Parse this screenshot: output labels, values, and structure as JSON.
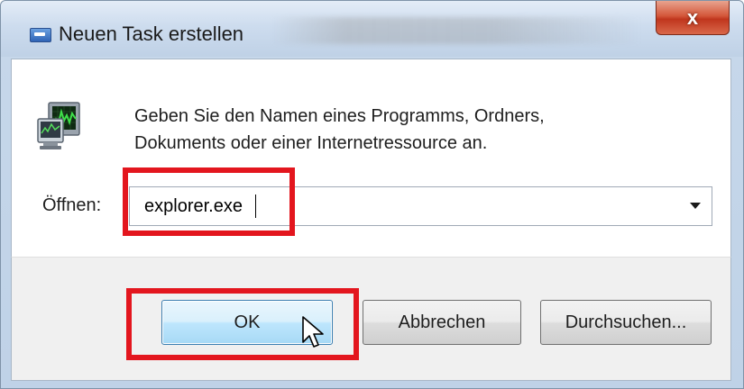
{
  "window": {
    "title": "Neuen Task erstellen",
    "close_label": "x",
    "title_icon": "run-dialog-icon"
  },
  "dialog": {
    "prompt_line1": "Geben Sie den Namen eines Programms, Ordners,",
    "prompt_line2": "Dokuments oder einer Internetressource an.",
    "prompt_icon": "task-manager-monitor-icon",
    "open_label": "Öffnen:",
    "open_value": "explorer.exe"
  },
  "buttons": {
    "ok": "OK",
    "cancel": "Abbrechen",
    "browse": "Durchsuchen..."
  },
  "annotations": {
    "highlight_color": "#e3161e"
  }
}
